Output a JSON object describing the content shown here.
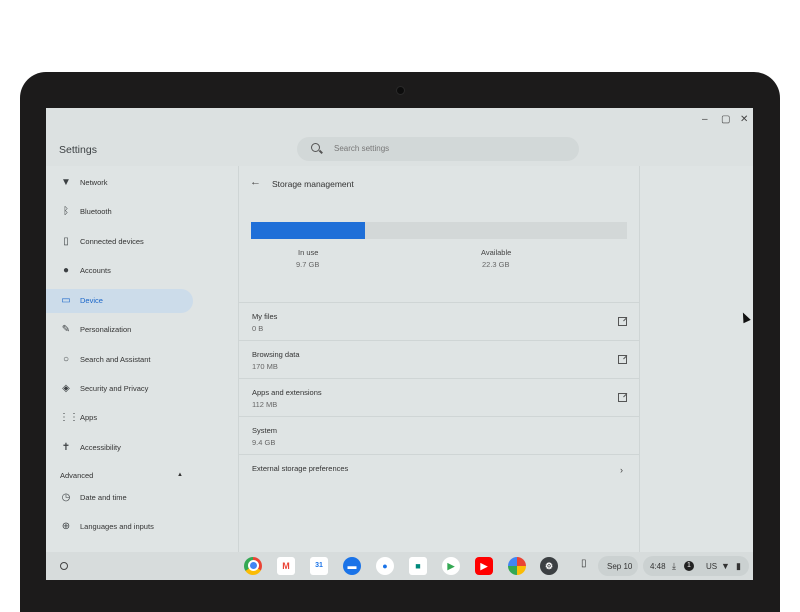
{
  "window": {
    "title": "Settings",
    "controls": [
      "–",
      "▢",
      "✕"
    ]
  },
  "search": {
    "placeholder": "Search settings"
  },
  "sidebar": {
    "items": [
      {
        "label": "Network",
        "icon": "wifi-icon"
      },
      {
        "label": "Bluetooth",
        "icon": "bluetooth-icon"
      },
      {
        "label": "Connected devices",
        "icon": "phone-icon"
      },
      {
        "label": "Accounts",
        "icon": "person-icon"
      },
      {
        "label": "Device",
        "icon": "laptop-icon",
        "active": true
      },
      {
        "label": "Personalization",
        "icon": "brush-icon"
      },
      {
        "label": "Search and Assistant",
        "icon": "search-icon"
      },
      {
        "label": "Security and Privacy",
        "icon": "shield-icon"
      },
      {
        "label": "Apps",
        "icon": "apps-grid-icon"
      },
      {
        "label": "Accessibility",
        "icon": "accessibility-icon"
      }
    ],
    "advanced_label": "Advanced",
    "advanced_items": [
      {
        "label": "Date and time",
        "icon": "clock-icon"
      },
      {
        "label": "Languages and inputs",
        "icon": "globe-icon"
      }
    ]
  },
  "main": {
    "title": "Storage management",
    "usage": {
      "in_use_label": "In use",
      "in_use_value": "9.7 GB",
      "available_label": "Available",
      "available_value": "22.3 GB",
      "fraction_used": 0.303
    },
    "rows": [
      {
        "title": "My files",
        "sub": "0 B",
        "action": "external-link-icon"
      },
      {
        "title": "Browsing data",
        "sub": "170 MB",
        "action": "external-link-icon"
      },
      {
        "title": "Apps and extensions",
        "sub": "112 MB",
        "action": "external-link-icon"
      },
      {
        "title": "System",
        "sub": "9.4 GB",
        "action": ""
      },
      {
        "title": "External storage preferences",
        "sub": "",
        "action": "chevron-right-icon"
      }
    ]
  },
  "shelf": {
    "apps": [
      "chrome-icon",
      "gmail-icon",
      "calendar-icon",
      "files-icon",
      "messages-icon",
      "meet-icon",
      "play-store-icon",
      "youtube-icon",
      "photos-icon",
      "settings-icon"
    ],
    "phone_hub": "phone-icon",
    "date": "Sep 10",
    "time": "4:48",
    "notification_count": "1",
    "input_method": "US",
    "accent": "#1f6fd8"
  }
}
